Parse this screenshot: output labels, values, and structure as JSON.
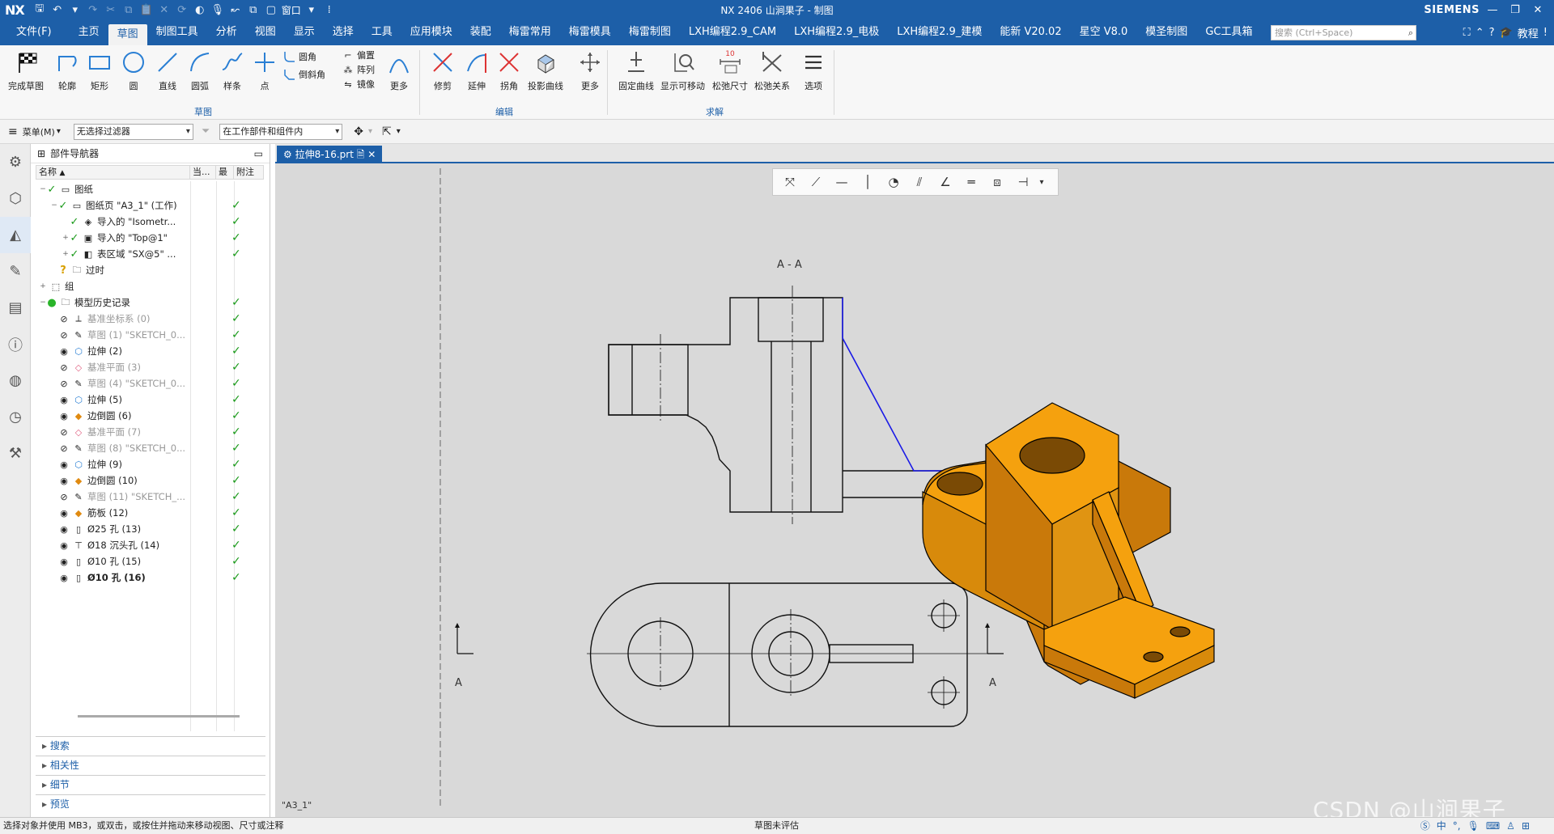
{
  "app": {
    "logo": "NX",
    "title": "NX 2406 山涧果子 - 制图",
    "brand": "SIEMENS",
    "window_menu": "窗口"
  },
  "menubar": {
    "items": [
      "文件(F)",
      "主页",
      "草图",
      "制图工具",
      "分析",
      "视图",
      "显示",
      "选择",
      "工具",
      "应用模块",
      "装配",
      "梅雷常用",
      "梅雷模具",
      "梅雷制图",
      "LXH编程2.9_CAM",
      "LXH编程2.9_电极",
      "LXH编程2.9_建模",
      "能新 V20.02",
      "星空 V8.0",
      "模圣制图",
      "GC工具箱"
    ],
    "active_index": 2,
    "search_placeholder": "搜索 (Ctrl+Space)",
    "tutorial": "教程"
  },
  "ribbon": {
    "big": [
      {
        "id": "finish",
        "label": "完成草图",
        "icon": "finish-flag-icon"
      },
      {
        "id": "profile",
        "label": "轮廓",
        "icon": "profile-icon"
      },
      {
        "id": "rect",
        "label": "矩形",
        "icon": "rectangle-icon"
      },
      {
        "id": "circle",
        "label": "圆",
        "icon": "circle-icon"
      },
      {
        "id": "line",
        "label": "直线",
        "icon": "line-icon"
      },
      {
        "id": "arc",
        "label": "圆弧",
        "icon": "arc-icon"
      },
      {
        "id": "spline",
        "label": "样条",
        "icon": "spline-icon"
      },
      {
        "id": "point",
        "label": "点",
        "icon": "point-icon"
      },
      {
        "id": "more1",
        "label": "更多",
        "icon": "more-curves-icon"
      },
      {
        "id": "trim",
        "label": "修剪",
        "icon": "trim-icon"
      },
      {
        "id": "extend",
        "label": "延伸",
        "icon": "extend-icon"
      },
      {
        "id": "corner",
        "label": "拐角",
        "icon": "corner-icon"
      },
      {
        "id": "project",
        "label": "投影曲线",
        "icon": "project-curve-icon"
      },
      {
        "id": "more2",
        "label": "更多",
        "icon": "move-more-icon"
      },
      {
        "id": "fix",
        "label": "固定曲线",
        "icon": "fix-curve-icon"
      },
      {
        "id": "showmove",
        "label": "显示可移动",
        "icon": "show-movable-icon"
      },
      {
        "id": "relaxdim",
        "label": "松弛尺寸",
        "icon": "relax-dimension-icon"
      },
      {
        "id": "relaxrel",
        "label": "松弛关系",
        "icon": "relax-relation-icon"
      },
      {
        "id": "options",
        "label": "选项",
        "icon": "options-menu-icon"
      }
    ],
    "small": {
      "fillet": "圆角",
      "chamfer": "倒斜角",
      "offset": "偏置",
      "pattern": "阵列",
      "mirror": "镜像"
    },
    "groups": {
      "sketch": "草图",
      "edit": "编辑",
      "solve": "求解"
    },
    "relax_value": "10"
  },
  "filterbar": {
    "menu": "菜单(M)",
    "filter": "无选择过滤器",
    "scope": "在工作部件和组件内"
  },
  "navigator": {
    "title": "部件导航器",
    "columns": [
      "名称",
      "当...",
      "最",
      "附注"
    ],
    "rows": [
      {
        "t": "图纸",
        "indent": 0,
        "ex": "−",
        "eye": "",
        "ck": "✓",
        "icon": "drawing-sheets-icon",
        "g": "▭",
        "lt": false,
        "dim": false,
        "bold": false
      },
      {
        "t": "图纸页 \"A3_1\" (工作)",
        "indent": 1,
        "ex": "−",
        "eye": "",
        "ck": "✓",
        "icon": "sheet-icon",
        "g": "▭",
        "lt": true,
        "dim": false,
        "bold": false
      },
      {
        "t": "导入的 \"Isometr...",
        "indent": 2,
        "ex": "",
        "eye": "",
        "ck": "✓",
        "icon": "isometric-view-icon",
        "g": "◈",
        "lt": true,
        "dim": false,
        "bold": false
      },
      {
        "t": "导入的 \"Top@1\"",
        "indent": 2,
        "ex": "+",
        "eye": "",
        "ck": "✓",
        "icon": "top-view-icon",
        "g": "▣",
        "lt": true,
        "dim": false,
        "bold": false
      },
      {
        "t": "表区域 \"SX@5\" ...",
        "indent": 2,
        "ex": "+",
        "eye": "",
        "ck": "✓",
        "icon": "section-view-icon",
        "g": "◧",
        "lt": true,
        "dim": false,
        "bold": false
      },
      {
        "t": "过时",
        "indent": 1,
        "ex": "",
        "eye": "",
        "ck": "?",
        "icon": "outdated-folder-icon",
        "g": "🗀",
        "lt": false,
        "dim": false,
        "bold": false
      },
      {
        "t": "组",
        "indent": 0,
        "ex": "+",
        "eye": "",
        "ck": "",
        "icon": "group-icon",
        "g": "⬚",
        "lt": false,
        "dim": false,
        "bold": false
      },
      {
        "t": "模型历史记录",
        "indent": 0,
        "ex": "−",
        "eye": "",
        "ck": "●",
        "icon": "model-history-icon",
        "g": "🗀",
        "lt": true,
        "dim": false,
        "bold": false
      },
      {
        "t": "基准坐标系 (0)",
        "indent": 1,
        "ex": "",
        "eye": "⊘",
        "ck": "",
        "icon": "datum-csys-icon",
        "g": "⟂",
        "lt": true,
        "dim": true,
        "bold": false
      },
      {
        "t": "草图 (1) \"SKETCH_0...",
        "indent": 1,
        "ex": "",
        "eye": "⊘",
        "ck": "",
        "icon": "sketch-feature-icon",
        "g": "✎",
        "lt": true,
        "dim": true,
        "bold": false
      },
      {
        "t": "拉伸 (2)",
        "indent": 1,
        "ex": "",
        "eye": "◉",
        "ck": "",
        "icon": "extrude-icon",
        "g": "⬡",
        "lt": true,
        "dim": false,
        "bold": false
      },
      {
        "t": "基准平面 (3)",
        "indent": 1,
        "ex": "",
        "eye": "⊘",
        "ck": "",
        "icon": "datum-plane-icon",
        "g": "◇",
        "lt": true,
        "dim": true,
        "bold": false
      },
      {
        "t": "草图 (4) \"SKETCH_0...",
        "indent": 1,
        "ex": "",
        "eye": "⊘",
        "ck": "",
        "icon": "sketch-feature-icon",
        "g": "✎",
        "lt": true,
        "dim": true,
        "bold": false
      },
      {
        "t": "拉伸 (5)",
        "indent": 1,
        "ex": "",
        "eye": "◉",
        "ck": "",
        "icon": "extrude-icon",
        "g": "⬡",
        "lt": true,
        "dim": false,
        "bold": false
      },
      {
        "t": "边倒圆 (6)",
        "indent": 1,
        "ex": "",
        "eye": "◉",
        "ck": "",
        "icon": "edge-blend-icon",
        "g": "◆",
        "lt": true,
        "dim": false,
        "bold": false
      },
      {
        "t": "基准平面 (7)",
        "indent": 1,
        "ex": "",
        "eye": "⊘",
        "ck": "",
        "icon": "datum-plane-icon",
        "g": "◇",
        "lt": true,
        "dim": true,
        "bold": false
      },
      {
        "t": "草图 (8) \"SKETCH_0...",
        "indent": 1,
        "ex": "",
        "eye": "⊘",
        "ck": "",
        "icon": "sketch-feature-icon",
        "g": "✎",
        "lt": true,
        "dim": true,
        "bold": false
      },
      {
        "t": "拉伸 (9)",
        "indent": 1,
        "ex": "",
        "eye": "◉",
        "ck": "",
        "icon": "extrude-icon",
        "g": "⬡",
        "lt": true,
        "dim": false,
        "bold": false
      },
      {
        "t": "边倒圆 (10)",
        "indent": 1,
        "ex": "",
        "eye": "◉",
        "ck": "",
        "icon": "edge-blend-icon",
        "g": "◆",
        "lt": true,
        "dim": false,
        "bold": false
      },
      {
        "t": "草图 (11) \"SKETCH_...",
        "indent": 1,
        "ex": "",
        "eye": "⊘",
        "ck": "",
        "icon": "sketch-feature-icon",
        "g": "✎",
        "lt": true,
        "dim": true,
        "bold": false
      },
      {
        "t": "筋板 (12)",
        "indent": 1,
        "ex": "",
        "eye": "◉",
        "ck": "",
        "icon": "rib-icon",
        "g": "◆",
        "lt": true,
        "dim": false,
        "bold": false
      },
      {
        "t": "Ø25 孔 (13)",
        "indent": 1,
        "ex": "",
        "eye": "◉",
        "ck": "",
        "icon": "hole-icon",
        "g": "▯",
        "lt": true,
        "dim": false,
        "bold": false
      },
      {
        "t": "Ø18 沉头孔 (14)",
        "indent": 1,
        "ex": "",
        "eye": "◉",
        "ck": "",
        "icon": "counterbore-hole-icon",
        "g": "⊤",
        "lt": true,
        "dim": false,
        "bold": false
      },
      {
        "t": "Ø10 孔 (15)",
        "indent": 1,
        "ex": "",
        "eye": "◉",
        "ck": "",
        "icon": "hole-icon",
        "g": "▯",
        "lt": true,
        "dim": false,
        "bold": false
      },
      {
        "t": "Ø10 孔 (16)",
        "indent": 1,
        "ex": "",
        "eye": "◉",
        "ck": "",
        "icon": "hole-icon",
        "g": "▯",
        "lt": true,
        "dim": false,
        "bold": true
      }
    ],
    "panels": [
      "搜索",
      "相关性",
      "细节",
      "预览"
    ]
  },
  "graphics": {
    "tab": "拉伸8-16.prt",
    "section_label": "A - A",
    "cut_label": "A",
    "sheet_name": "\"A3_1\"",
    "watermark": "CSDN @山涧果子",
    "colors": {
      "part": "#f5a10e",
      "part_dark": "#c9790a",
      "sketch_curve": "#1a1ae6",
      "bg": "#d9d9d9",
      "accent": "#1d5fa8"
    }
  },
  "status": {
    "left": "选择对象并使用 MB3，或双击，或按住并拖动来移动视图、尺寸或注释",
    "center": "草图未评估",
    "ime": "中"
  }
}
